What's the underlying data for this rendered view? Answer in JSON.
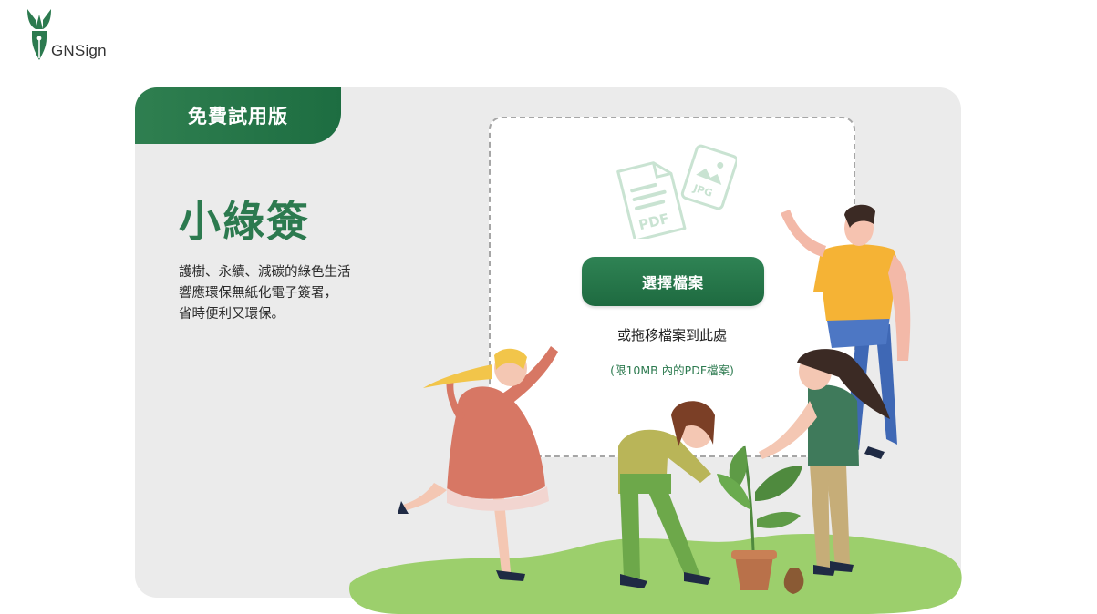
{
  "brand": {
    "logo_text": "GNSign",
    "accent": "#2c7a4f",
    "icon": "leaf-pen-logo-icon"
  },
  "card": {
    "badge_label": "免費試用版",
    "title": "小綠簽",
    "tagline_lines": [
      "護樹、永續、減碳的綠色生活",
      "響應環保無紙化電子簽署，",
      "省時便利又環保。"
    ]
  },
  "upload": {
    "file_type_icons": [
      "PDF",
      "JPG"
    ],
    "select_button_label": "選擇檔案",
    "drag_hint": "或拖移檔案到此處",
    "limit_note": "(限10MB 內的PDF檔案)"
  },
  "colors": {
    "card_bg": "#ebebeb",
    "button": "#2c7a4f",
    "grass": "#9ccf6c"
  }
}
